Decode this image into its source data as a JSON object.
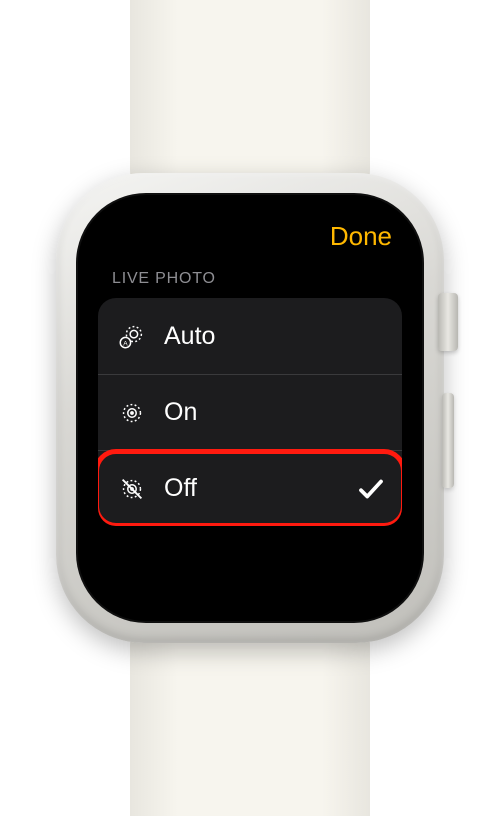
{
  "header": {
    "done_label": "Done"
  },
  "section": {
    "title": "LIVE PHOTO"
  },
  "options": {
    "auto": {
      "label": "Auto"
    },
    "on": {
      "label": "On"
    },
    "off": {
      "label": "Off"
    }
  },
  "selected_option": "off",
  "highlighted_option": "off",
  "colors": {
    "accent": "#ffb800",
    "highlight": "#ff1a0f"
  }
}
